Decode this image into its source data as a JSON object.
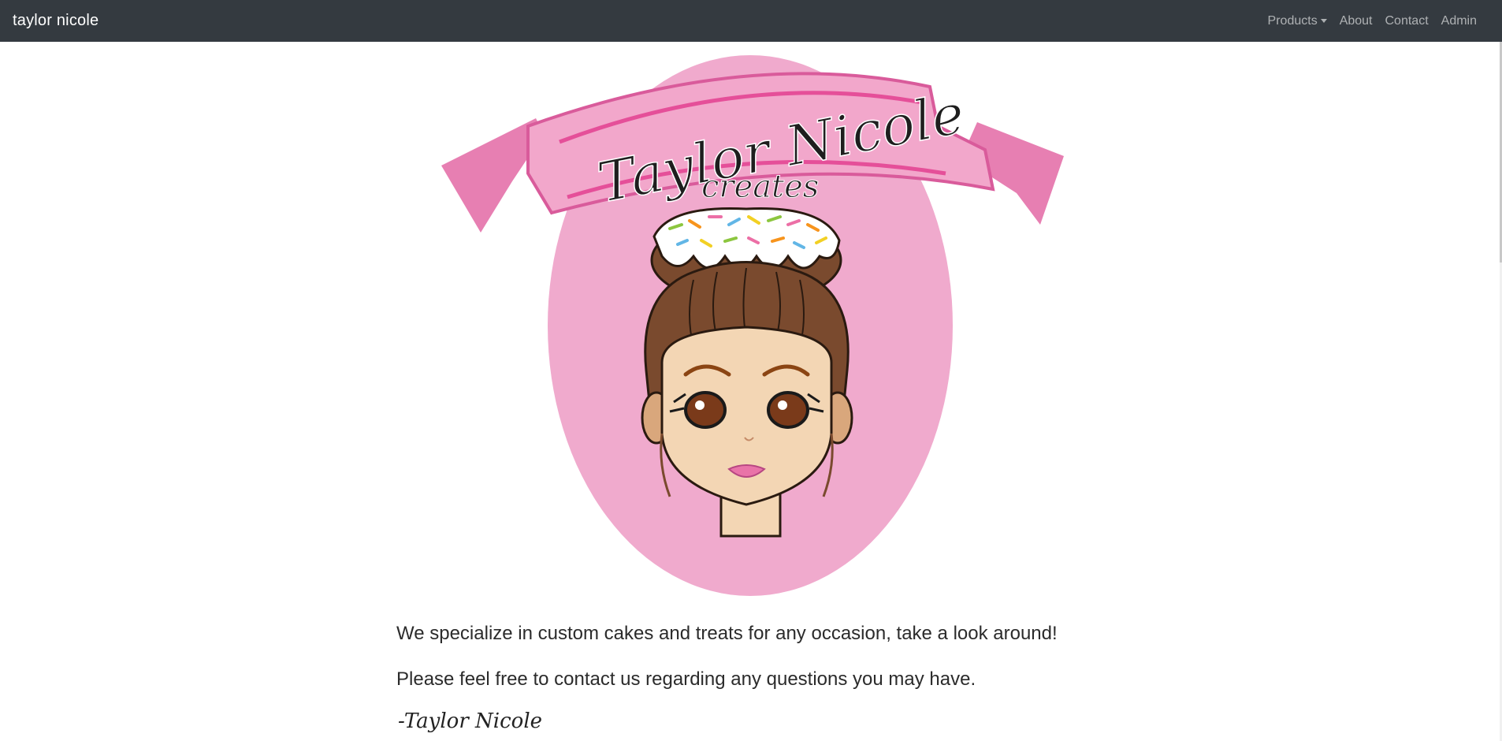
{
  "navbar": {
    "brand": "taylor nicole",
    "items": [
      {
        "label": "Products",
        "dropdown": true
      },
      {
        "label": "About"
      },
      {
        "label": "Contact"
      },
      {
        "label": "Admin"
      }
    ]
  },
  "logo": {
    "ribbon_text": "Taylor Nicole",
    "subtext": "creates"
  },
  "content": {
    "line1": "We specialize in custom cakes and treats for any occasion, take a look around!",
    "line2": "Please feel free to contact us regarding any questions you may have.",
    "signature": "-Taylor Nicole"
  },
  "colors": {
    "navbar_bg": "#343a40",
    "oval_pink": "#f0aacd",
    "ribbon_pink": "#e86aa8",
    "hair_brown": "#7a4a2e",
    "skin": "#f3d6b4"
  }
}
